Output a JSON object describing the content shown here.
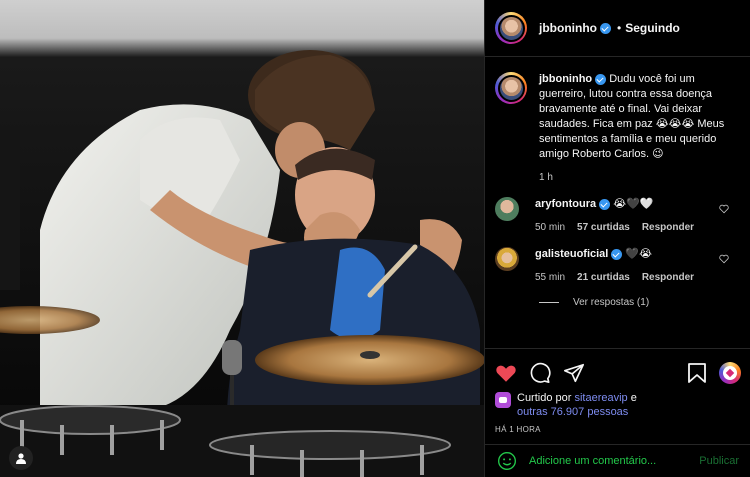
{
  "post": {
    "author": "jbboninho",
    "follow_state": "Seguindo",
    "separator": "•"
  },
  "caption": {
    "author": "jbboninho",
    "text": "Dudu você foi um guerreiro, lutou contra essa doença bravamente até o final. Vai deixar saudades. Fica em paz 😭😭😭 Meus sentimentos a família e meu querido amigo Roberto Carlos. 😉",
    "time": "1 h"
  },
  "comments": [
    {
      "username": "aryfontoura",
      "verified": true,
      "text": "😭🖤🤍",
      "time": "50 min",
      "likes": "57 curtidas",
      "reply": "Responder"
    },
    {
      "username": "galisteuoficial",
      "verified": true,
      "text": "🖤😭",
      "time": "55 min",
      "likes": "21 curtidas",
      "reply": "Responder",
      "view_replies": "Ver respostas (1)"
    }
  ],
  "likes": {
    "prefix": "Curtido por",
    "liker": "sitaereavip",
    "conj": "e",
    "others": "outras 76.907 pessoas"
  },
  "posted_time": "HÁ 1 HORA",
  "comment_input": {
    "placeholder": "Adicione um comentário...",
    "publish": "Publicar"
  },
  "icons": {
    "like": "heart-icon",
    "comment": "comment-icon",
    "share": "share-icon",
    "save": "bookmark-icon",
    "emoji": "smiley-icon",
    "user_tag": "user-icon"
  },
  "colors": {
    "like_red": "#ed4956",
    "verified_blue": "#3897f0",
    "comment_green": "#23c94b",
    "publish_green": "#1a6f33",
    "link_blue": "#7e8cf0"
  }
}
